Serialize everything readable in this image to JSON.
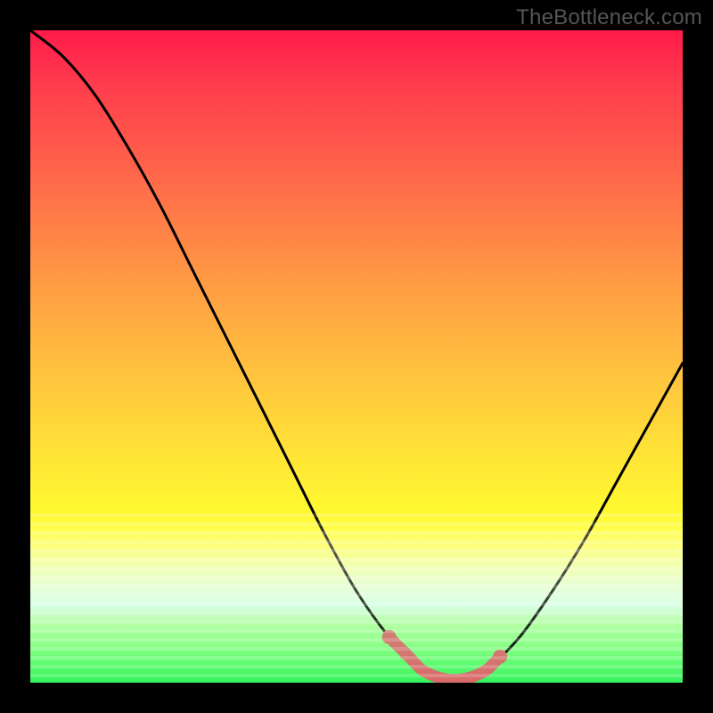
{
  "watermark": "TheBottleneck.com",
  "colors": {
    "background": "#000000",
    "curve": "#000000",
    "highlight": "#e06666",
    "gradient_top": "#ff1a4a",
    "gradient_mid": "#ffe636",
    "gradient_bottom": "#33f35b"
  },
  "chart_data": {
    "type": "line",
    "title": "",
    "xlabel": "",
    "ylabel": "",
    "xlim": [
      0,
      100
    ],
    "ylim": [
      0,
      100
    ],
    "x": [
      0,
      5,
      10,
      15,
      20,
      25,
      30,
      35,
      40,
      45,
      50,
      55,
      58,
      60,
      62,
      64,
      66,
      68,
      70,
      75,
      80,
      85,
      90,
      95,
      100
    ],
    "values": [
      100,
      96,
      90,
      82,
      73,
      63,
      53,
      43,
      33,
      23,
      14,
      7,
      4,
      2,
      1,
      0.5,
      0.5,
      1,
      2,
      7,
      14,
      22,
      31,
      40,
      49
    ],
    "optimal_region": {
      "x_start": 55,
      "x_end": 72,
      "note": "highlighted near-zero bottleneck zone"
    }
  }
}
